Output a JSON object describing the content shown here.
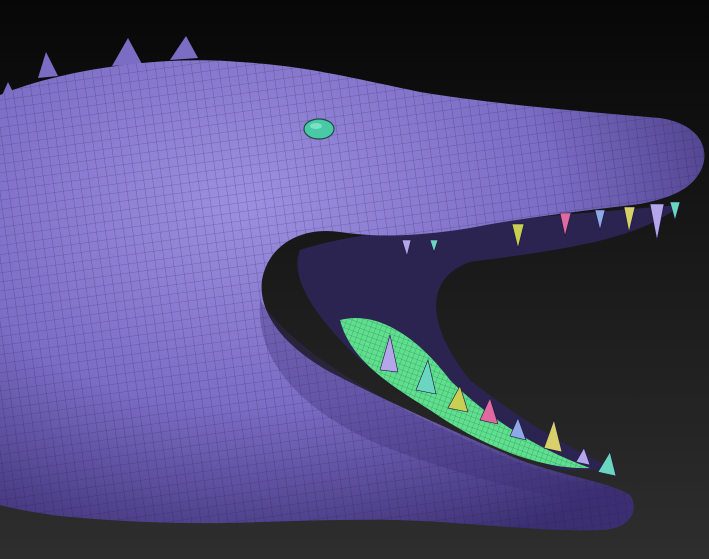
{
  "viewport": {
    "title": "",
    "subject": "mosasaur-head-sculpt",
    "render_mode": "wireframe-polyframe"
  },
  "colors": {
    "background_top": "#070707",
    "background_bottom": "#2e2e2e",
    "skin_base": "#7b6cc4",
    "skin_highlight": "#9d8fe0",
    "skin_shadow": "#3b2f72",
    "wire": "#1c1540",
    "eye": "#49c9a6",
    "tongue": "#5fe08e",
    "mouth_interior": "#2b2350",
    "teeth": [
      "#b4a6e8",
      "#6bd6c0",
      "#c9cf52",
      "#e06aa0",
      "#8fa8e6",
      "#d8d06a"
    ]
  },
  "icons": {
    "eye": "eye-shape",
    "teeth": "tooth-spike",
    "dorsal_spikes": "spike-shape"
  }
}
